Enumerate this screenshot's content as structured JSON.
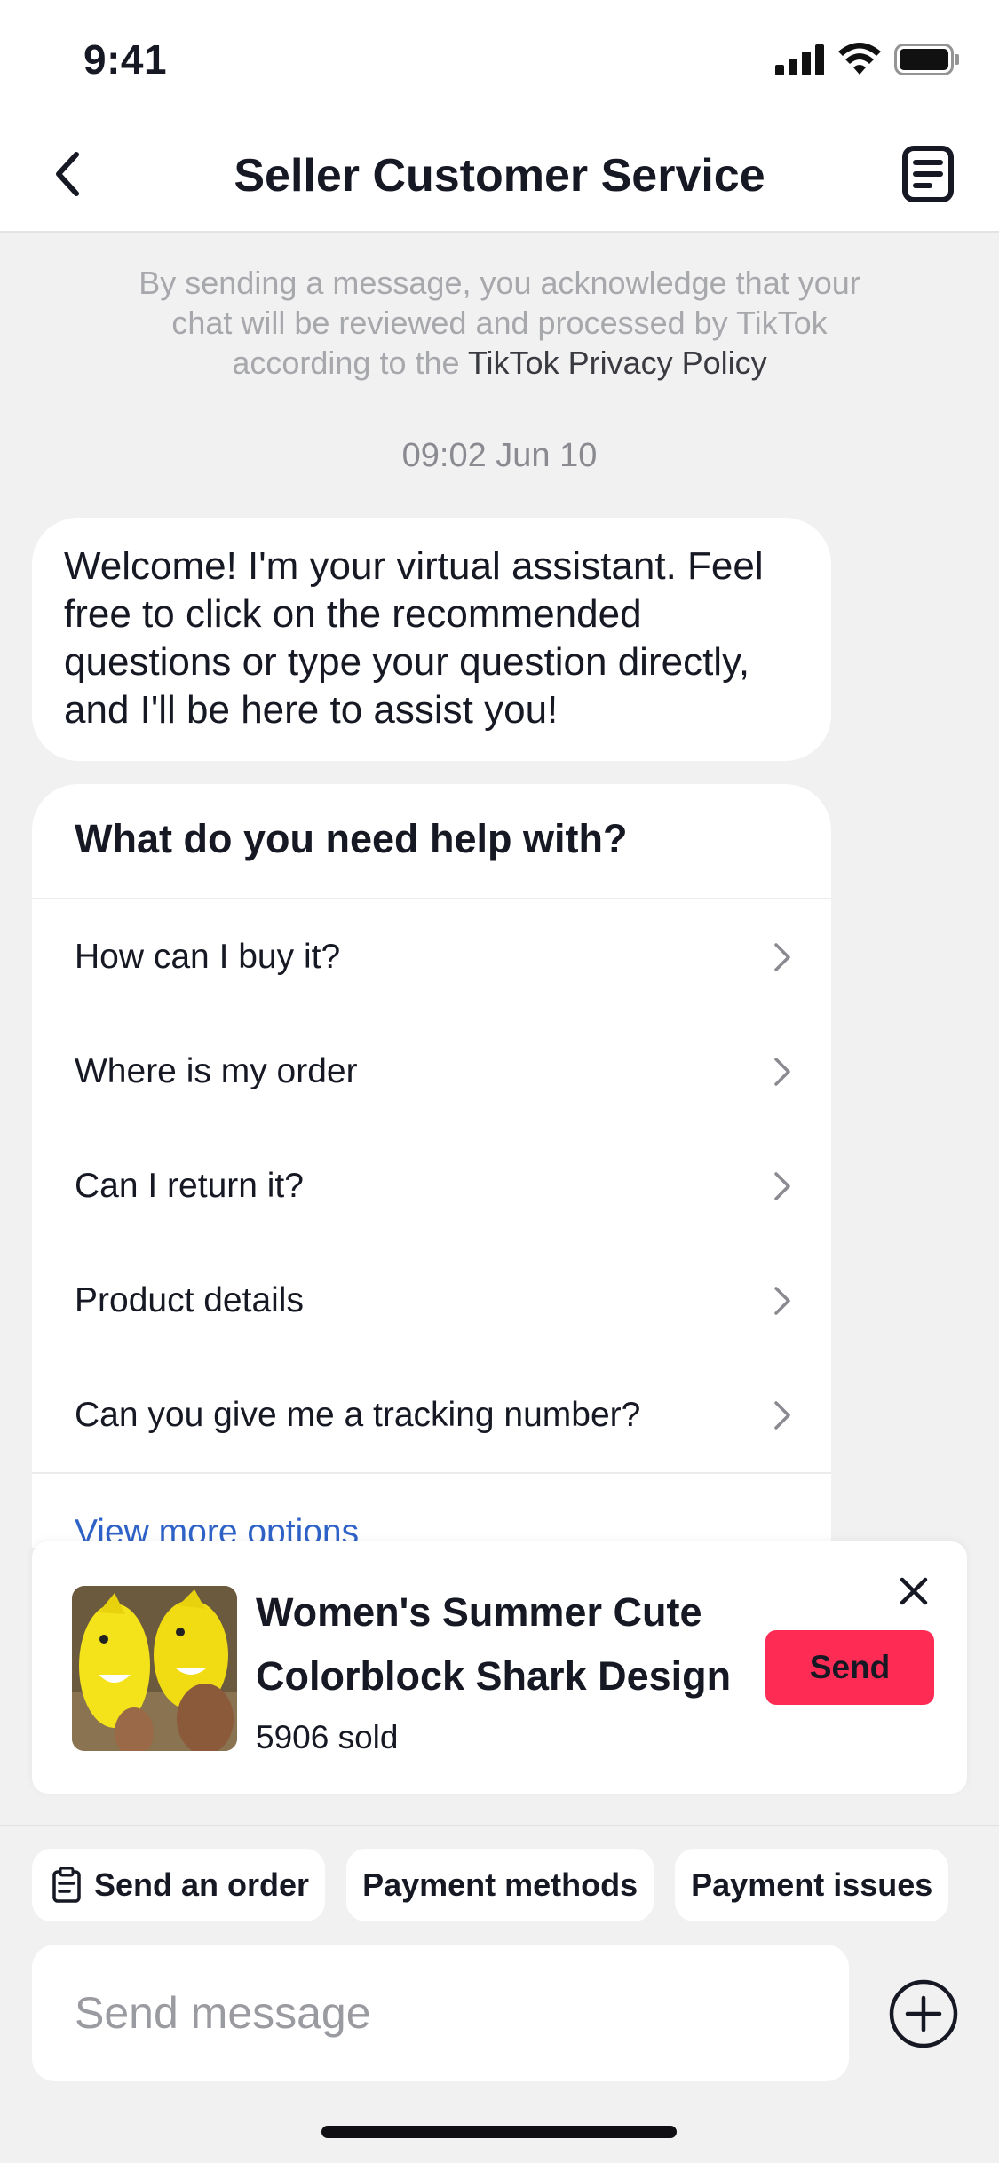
{
  "status_bar": {
    "time": "9:41"
  },
  "header": {
    "title": "Seller Customer Service"
  },
  "disclaimer": {
    "text": "By sending a message, you acknowledge that your chat will be reviewed and processed by TikTok according to the",
    "link": "TikTok Privacy Policy"
  },
  "timestamp": "09:02 Jun 10",
  "welcome_message": "Welcome! I'm your virtual assistant. Feel free to click on the recommended questions or type your question directly, and I'll be here to assist you!",
  "help": {
    "title": "What do you need help with?",
    "items": [
      {
        "label": "How can I buy it?"
      },
      {
        "label": "Where is my order"
      },
      {
        "label": "Can I return it?"
      },
      {
        "label": "Product details"
      },
      {
        "label": "Can you give me a tracking number?"
      }
    ],
    "view_more": "View more options"
  },
  "product": {
    "title_line1": "Women's Summer Cute",
    "title_line2": "Colorblock Shark Design",
    "sold": "5906 sold",
    "send_label": "Send"
  },
  "quick_actions": [
    {
      "label": "Send an order",
      "icon": "clipboard-icon"
    },
    {
      "label": "Payment methods"
    },
    {
      "label": "Payment issues"
    }
  ],
  "composer": {
    "placeholder": "Send message"
  },
  "colors": {
    "accent": "#fe2c55",
    "link": "#2f62c7",
    "background": "#f1f1f2"
  }
}
